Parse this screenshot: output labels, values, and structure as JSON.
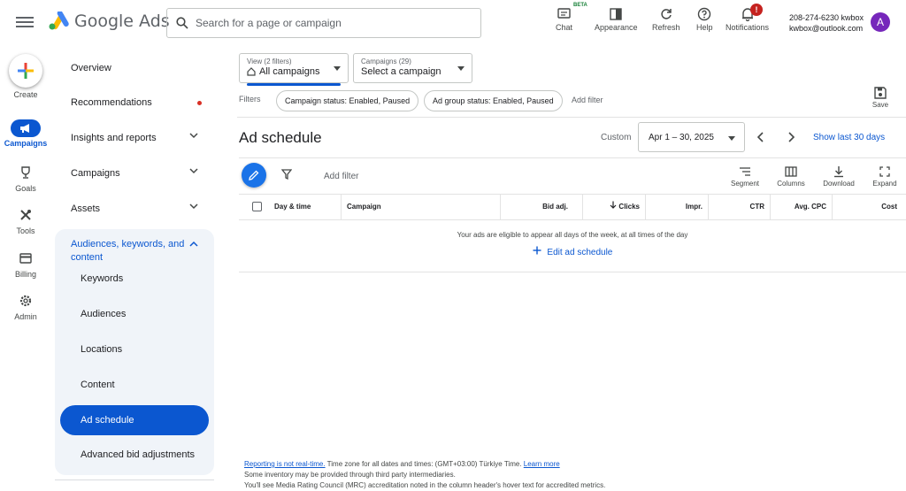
{
  "app": {
    "name": "Google Ads",
    "search_placeholder": "Search for a page or campaign"
  },
  "toolbar": {
    "chat": "Chat",
    "beta": "BETA",
    "appearance": "Appearance",
    "refresh": "Refresh",
    "help": "Help",
    "notifications": "Notifications",
    "notification_count": "!"
  },
  "account": {
    "id_line": "208-274-6230 kwbox",
    "email": "kwbox@outlook.com",
    "avatar_letter": "A",
    "avatar_color": "#7627bb"
  },
  "rail": {
    "create": "Create",
    "campaigns": "Campaigns",
    "goals": "Goals",
    "tools": "Tools",
    "billing": "Billing",
    "admin": "Admin"
  },
  "nav": {
    "overview": "Overview",
    "recommendations": "Recommendations",
    "insights": "Insights and reports",
    "campaigns": "Campaigns",
    "assets": "Assets",
    "group_title": "Audiences, keywords, and content",
    "sub": [
      "Keywords",
      "Audiences",
      "Locations",
      "Content",
      "Ad schedule",
      "Advanced bid adjustments"
    ]
  },
  "selectors": {
    "view_label": "View (2 filters)",
    "view_value": "All campaigns",
    "campaigns_label": "Campaigns (29)",
    "campaigns_value": "Select a campaign"
  },
  "filters": {
    "label": "Filters",
    "chips": [
      "Campaign status: Enabled, Paused",
      "Ad group status: Enabled, Paused"
    ],
    "add": "Add filter",
    "save": "Save"
  },
  "page": {
    "title": "Ad schedule",
    "custom": "Custom",
    "date_range": "Apr 1 – 30, 2025",
    "show_last": "Show last 30 days"
  },
  "table": {
    "add_filter": "Add filter",
    "segment": "Segment",
    "columns": "Columns",
    "download": "Download",
    "expand": "Expand",
    "headers": {
      "day_time": "Day & time",
      "campaign": "Campaign",
      "bid_adj": "Bid adj.",
      "clicks": "Clicks",
      "impr": "Impr.",
      "ctr": "CTR",
      "avg_cpc": "Avg. CPC",
      "cost": "Cost"
    },
    "empty_message": "Your ads are eligible to appear all days of the week, at all times of the day",
    "edit_link": "Edit ad schedule"
  },
  "footer": {
    "not_realtime": "Reporting is not real-time.",
    "timezone": " Time zone for all dates and times: (GMT+03:00) Türkiye Time. ",
    "learn_more": "Learn more",
    "line2": "Some inventory may be provided through third party intermediaries.",
    "line3": "You'll see Media Rating Council (MRC) accreditation noted in the column header's hover text for accredited metrics."
  },
  "colors": {
    "accent": "#0b57d0",
    "fab": "#1a73e8",
    "alert": "#c5221f"
  }
}
